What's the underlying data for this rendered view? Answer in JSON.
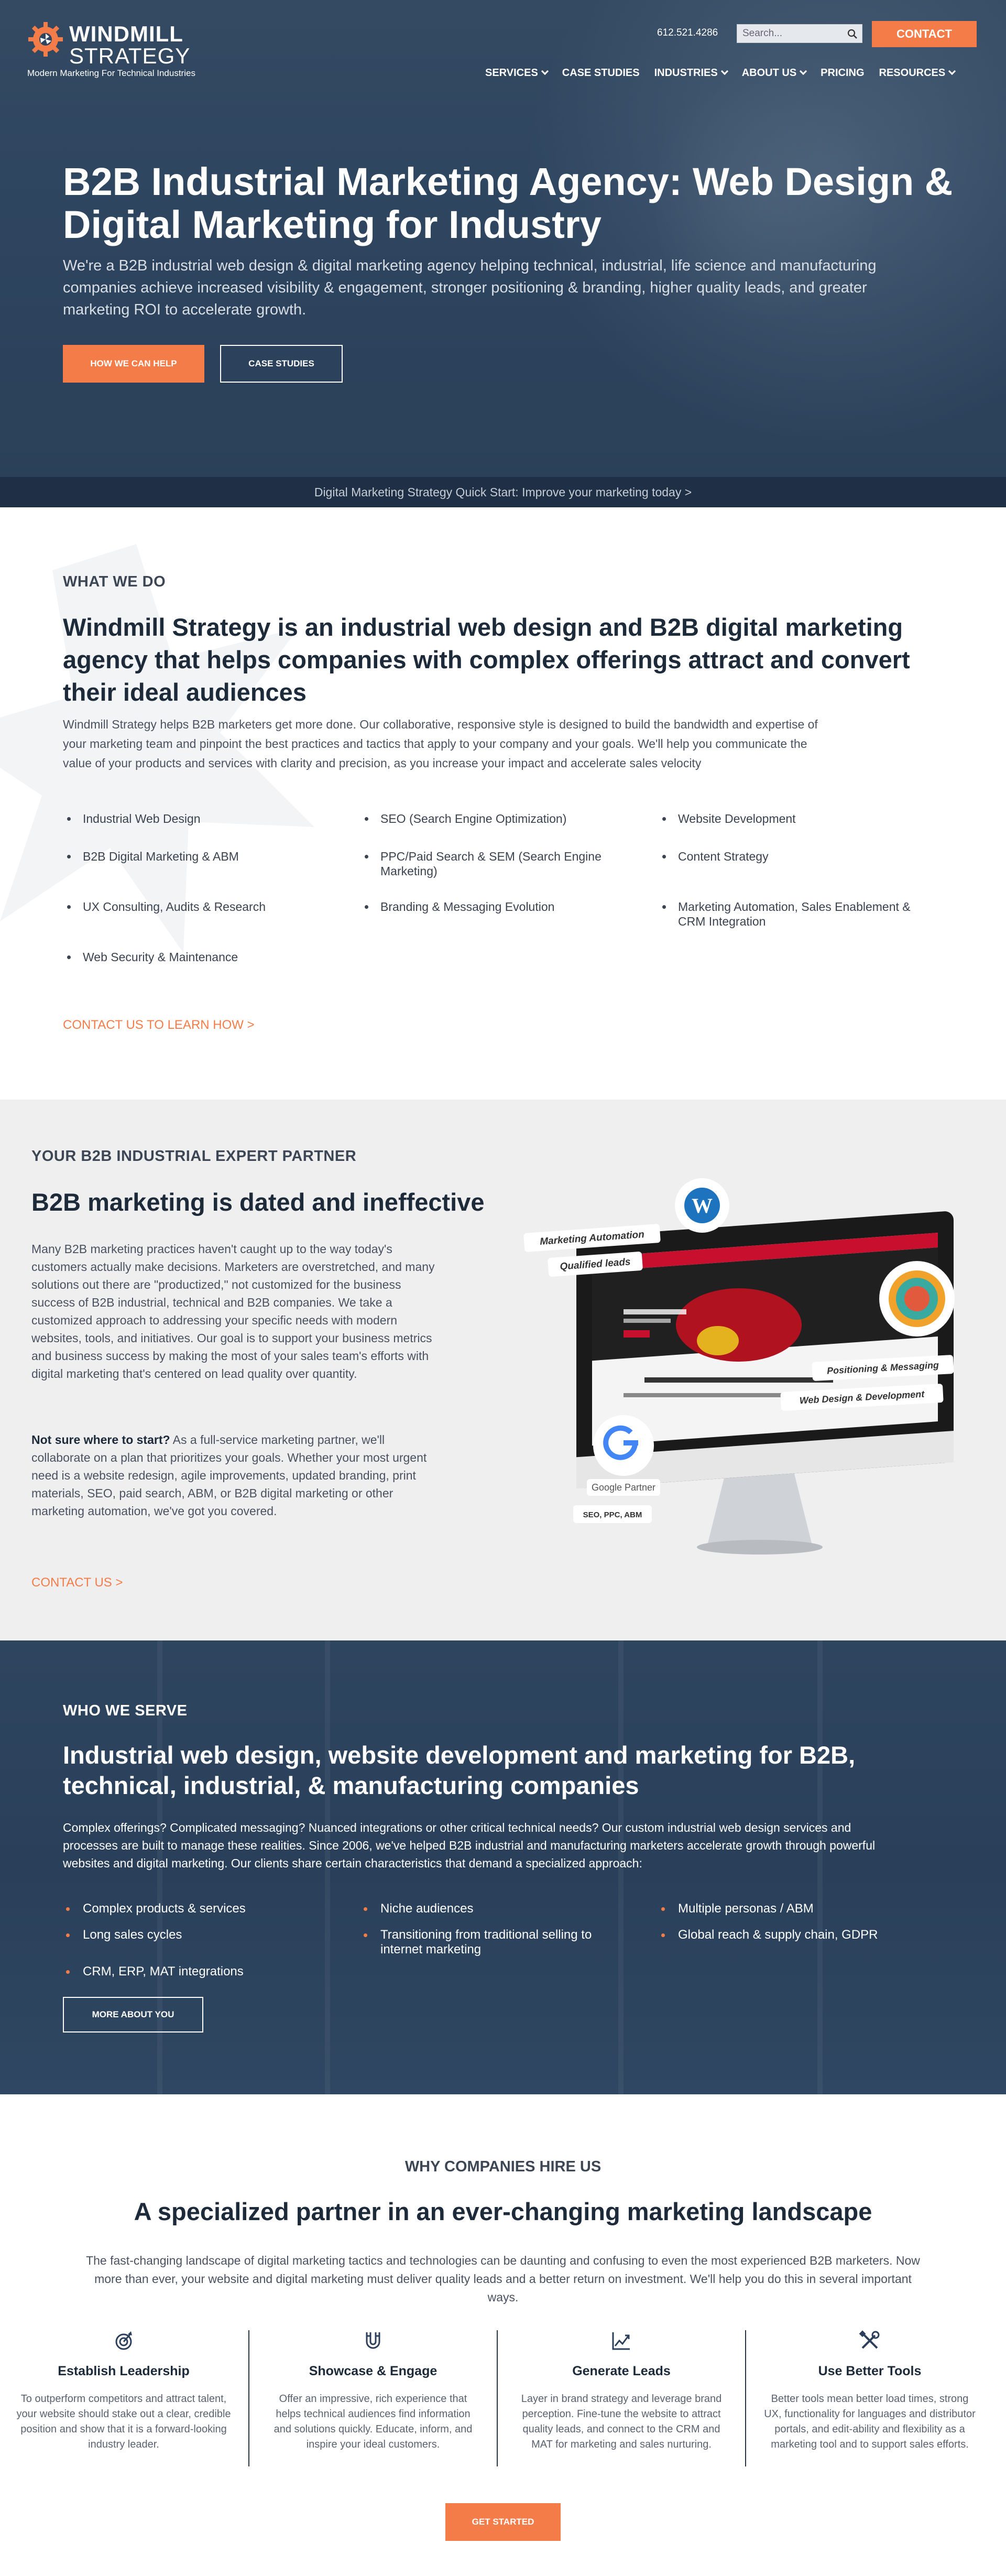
{
  "brand": {
    "name_line1": "WINDMILL",
    "name_line2": "STRATEGY",
    "tagline": "Modern Marketing For Technical Industries",
    "accent": "#f47c48",
    "navy": "#2e4560"
  },
  "header": {
    "phone": "612.521.4286",
    "search_placeholder": "Search...",
    "contact_label": "CONTACT",
    "nav": [
      {
        "label": "SERVICES",
        "has_dropdown": true
      },
      {
        "label": "CASE STUDIES",
        "has_dropdown": false
      },
      {
        "label": "INDUSTRIES",
        "has_dropdown": true
      },
      {
        "label": "ABOUT US",
        "has_dropdown": true
      },
      {
        "label": "PRICING",
        "has_dropdown": false
      },
      {
        "label": "RESOURCES",
        "has_dropdown": true
      }
    ]
  },
  "hero": {
    "title": "B2B Industrial Marketing Agency: Web Design & Digital Marketing for Industry",
    "subtitle": "We're a B2B industrial web design & digital marketing agency helping technical, industrial, life science and manufacturing companies achieve increased visibility & engagement, stronger positioning & branding, higher quality leads, and greater marketing ROI to accelerate growth.",
    "primary_cta": "HOW WE CAN HELP",
    "secondary_cta": "CASE STUDIES",
    "quickstart": "Digital Marketing Strategy Quick Start: Improve your marketing today >"
  },
  "what_we_do": {
    "eyebrow": "WHAT WE DO",
    "heading": "Windmill Strategy is an industrial web design and B2B digital marketing agency that helps companies with complex offerings attract and convert their ideal audiences",
    "body": "Windmill Strategy helps B2B marketers get more done. Our collaborative, responsive style is designed to build the bandwidth and expertise of your marketing team and pinpoint the best practices and tactics that apply to your company and your goals. We'll help you communicate the value of your products and services with clarity and precision, as you increase your impact and accelerate sales velocity",
    "services": [
      "Industrial Web Design",
      "SEO (Search Engine Optimization)",
      "Website Development",
      "B2B Digital Marketing & ABM",
      "PPC/Paid Search & SEM (Search Engine Marketing)",
      "Content Strategy",
      "UX Consulting, Audits & Research",
      "Branding & Messaging Evolution",
      "Marketing Automation, Sales Enablement & CRM Integration",
      "Web Security & Maintenance"
    ],
    "link": "CONTACT US TO LEARN HOW >"
  },
  "partner": {
    "eyebrow": "YOUR B2B INDUSTRIAL EXPERT PARTNER",
    "heading": "B2B marketing is dated and ineffective",
    "body1": "Many B2B marketing practices haven't caught up to the way today's customers actually make decisions. Marketers are overstretched, and many solutions out there are \"productized,\" not customized for the business success of B2B industrial, technical and B2B companies. We take a customized approach to addressing your specific needs with modern websites, tools, and initiatives. Our goal is to support your business metrics and business success by making the most of your sales team's efforts with digital marketing that's centered on lead quality over quantity.",
    "body2_bold": "Not sure where to start?",
    "body2": " As a full-service marketing partner, we'll collaborate on a plan that prioritizes your goals. Whether your most urgent need is a website redesign, agile improvements, updated branding, print materials, SEO, paid search, ABM, or B2B digital marketing or other marketing automation, we've got you covered.",
    "link": "CONTACT US >",
    "mockup_labels": {
      "marketing_automation": "Marketing Automation",
      "qualified_leads": "Qualified leads",
      "positioning": "Positioning & Messaging",
      "web_design": "Web Design & Development",
      "google_partner": "Google Partner",
      "seo_ppc": "SEO, PPC, ABM"
    }
  },
  "serve": {
    "eyebrow": "WHO WE SERVE",
    "heading": "Industrial web design, website development and marketing for B2B, technical, industrial, & manufacturing companies",
    "body": "Complex offerings? Complicated messaging? Nuanced integrations or other critical technical needs? Our custom industrial web design services and processes are built to manage these realities. Since 2006, we've helped B2B industrial and manufacturing marketers accelerate growth through powerful websites and digital marketing. Our clients share certain characteristics that demand a specialized approach:",
    "characteristics": [
      "Complex products & services",
      "Niche audiences",
      "Multiple personas / ABM",
      "Long sales cycles",
      "Transitioning from traditional selling to internet marketing",
      "Global reach & supply chain, GDPR",
      "CRM, ERP, MAT integrations"
    ],
    "cta": "MORE ABOUT YOU"
  },
  "why": {
    "eyebrow": "WHY COMPANIES HIRE US",
    "heading": "A specialized partner in an ever-changing marketing landscape",
    "body": "The fast-changing landscape of digital marketing tactics and technologies can be daunting and confusing to even the most experienced B2B marketers. Now more than ever, your website and digital marketing must deliver quality leads and a better return on investment. We'll help you do this in several important ways.",
    "columns": [
      {
        "icon": "target-icon",
        "title": "Establish Leadership",
        "text": "To outperform competitors and attract talent, your website should stake out a clear, credible position and show that it is a forward-looking industry leader."
      },
      {
        "icon": "magnet-icon",
        "title": "Showcase & Engage",
        "text": "Offer an impressive, rich experience that helps technical audiences find information and solutions quickly. Educate, inform, and inspire your ideal customers."
      },
      {
        "icon": "chart-line-icon",
        "title": "Generate Leads",
        "text": "Layer in brand strategy and leverage brand perception. Fine-tune the website to attract quality leads, and connect to the CRM and MAT for marketing and sales nurturing."
      },
      {
        "icon": "tools-icon",
        "title": "Use Better Tools",
        "text": "Better tools mean better load times, strong UX, functionality for languages and distributor portals, and edit-ability and flexibility as a marketing tool and to support sales efforts."
      }
    ],
    "cta": "GET STARTED"
  }
}
